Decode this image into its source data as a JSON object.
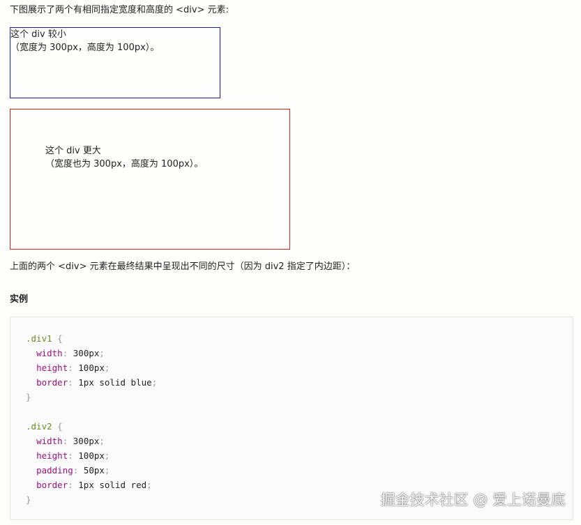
{
  "intro_text": "下图展示了两个有相同指定宽度和高度的 <div> 元素:",
  "box1": {
    "line1": "这个 div 较小",
    "line2": "（宽度为 300px，高度为 100px）。",
    "border_color": "#1a1aa8"
  },
  "box2": {
    "line1": "这个 div 更大",
    "line2": "（宽度也为 300px，高度为 100px）。",
    "border_color": "#e02020"
  },
  "after_text": "上面的两个 <div> 元素在最终结果中呈现出不同的尺寸（因为 div2 指定了内边距）：",
  "example_heading": "实例",
  "code": {
    "div1_selector": ".div1",
    "div1_width_prop": "width",
    "div1_width_val": "300px",
    "div1_height_prop": "height",
    "div1_height_val": "100px",
    "div1_border_prop": "border",
    "div1_border_val": "1px solid blue",
    "div2_selector": ".div2",
    "div2_width_prop": "width",
    "div2_width_val": "300px",
    "div2_height_prop": "height",
    "div2_height_val": "100px",
    "div2_padding_prop": "padding",
    "div2_padding_val": "50px",
    "div2_border_prop": "border",
    "div2_border_val": "1px solid red"
  },
  "watermark": "掘金技术社区 @ 爱上诺曼底"
}
